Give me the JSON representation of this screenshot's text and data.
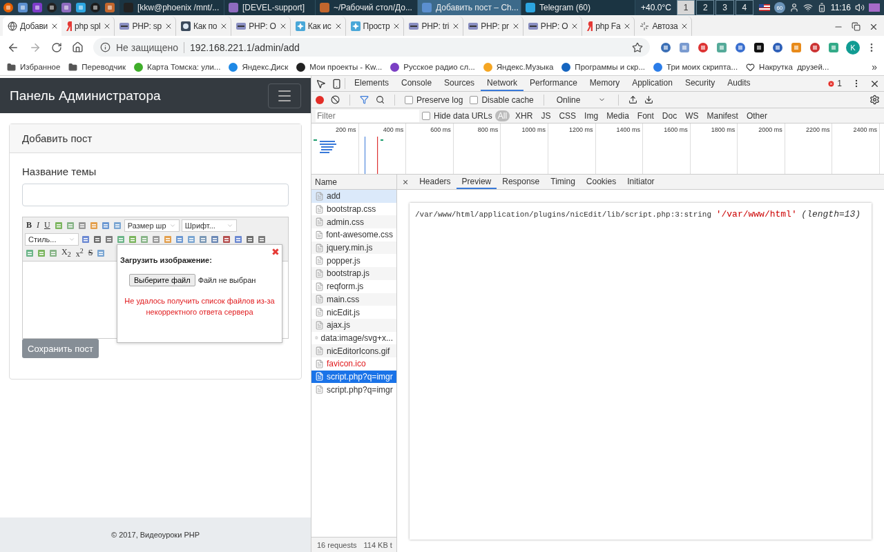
{
  "taskbar": {
    "windows": [
      {
        "title": "[kkw@phoenix /mnt/...",
        "kind": "terminal",
        "selected": false
      },
      {
        "title": "[DEVEL-support]",
        "kind": "folder",
        "selected": false
      },
      {
        "title": "~/Рабочий стол/До...",
        "kind": "editor",
        "selected": false
      },
      {
        "title": "Добавить пост – Ch...",
        "kind": "browser",
        "selected": true
      },
      {
        "title": "Telegram (60)",
        "kind": "telegram",
        "selected": false
      }
    ],
    "temperature": "+40.0°C",
    "workspaces": [
      {
        "label": "1",
        "selected": true
      },
      {
        "label": "2",
        "selected": false
      },
      {
        "label": "3",
        "selected": false
      },
      {
        "label": "4",
        "selected": false
      }
    ],
    "tray_badge": "60",
    "clock": "11:16"
  },
  "browser": {
    "tabs": [
      {
        "title": "Добави",
        "kind": "globe",
        "selected": true
      },
      {
        "title": "php spl",
        "kind": "yandex",
        "selected": false
      },
      {
        "title": "PHP: sp",
        "kind": "php",
        "selected": false
      },
      {
        "title": "Как по",
        "kind": "gem",
        "selected": false
      },
      {
        "title": "PHP: O",
        "kind": "php",
        "selected": false
      },
      {
        "title": "Как ис",
        "kind": "star",
        "selected": false
      },
      {
        "title": "Простр",
        "kind": "star",
        "selected": false
      },
      {
        "title": "PHP: tri",
        "kind": "php",
        "selected": false
      },
      {
        "title": "PHP: pr",
        "kind": "php",
        "selected": false
      },
      {
        "title": "PHP: O",
        "kind": "php",
        "selected": false
      },
      {
        "title": "php Fa",
        "kind": "yandex",
        "selected": false
      },
      {
        "title": "Автоза",
        "kind": "spinner",
        "selected": false
      }
    ],
    "security": "Не защищено",
    "url": "192.168.221.1/admin/add",
    "profile": "K",
    "bookmarks": [
      {
        "title": "Избранное",
        "kind": "folder"
      },
      {
        "title": "Переводчик",
        "kind": "folder"
      },
      {
        "title": "Карта Томска: ули...",
        "kind": "site",
        "color": "#3fae2a"
      },
      {
        "title": "Яндекс.Диск",
        "kind": "site",
        "color": "#1e88e5"
      },
      {
        "title": "Мои проекты - Kw...",
        "kind": "site",
        "color": "#222222"
      },
      {
        "title": "Русское радио сл...",
        "kind": "site",
        "color": "#7b3fc4"
      },
      {
        "title": "Яндекс.Музыка",
        "kind": "site",
        "color": "#f5a623"
      },
      {
        "title": "Программы и скр...",
        "kind": "site",
        "color": "#1565c0"
      },
      {
        "title": "Три моих скрипта...",
        "kind": "site",
        "color": "#2b7de9"
      },
      {
        "title": "Накрутка  друзей...",
        "kind": "heart"
      }
    ],
    "bookmarks_more": "»"
  },
  "admin": {
    "brand": "Панель Администратора",
    "card_title": "Добавить пост",
    "field_label": "Название темы",
    "toolbar": [
      [
        {
          "kind": "bold",
          "label": "B"
        },
        {
          "kind": "italic",
          "label": "I"
        },
        {
          "kind": "underline",
          "label": "U"
        },
        {
          "kind": "icon"
        },
        {
          "kind": "icon"
        },
        {
          "kind": "icon"
        },
        {
          "kind": "icon"
        },
        {
          "kind": "icon"
        },
        {
          "kind": "icon"
        },
        {
          "kind": "select",
          "label": "Размер шр"
        },
        {
          "kind": "select",
          "label": "Шрифт..."
        }
      ],
      [
        {
          "kind": "select",
          "label": "Стиль..."
        },
        {
          "kind": "icon"
        },
        {
          "kind": "icon"
        },
        {
          "kind": "icon"
        },
        {
          "kind": "icon"
        },
        {
          "kind": "icon"
        },
        {
          "kind": "icon"
        },
        {
          "kind": "icon"
        },
        {
          "kind": "icon"
        },
        {
          "kind": "icon"
        },
        {
          "kind": "icon"
        },
        {
          "kind": "icon"
        },
        {
          "kind": "icon"
        },
        {
          "kind": "icon"
        },
        {
          "kind": "icon"
        },
        {
          "kind": "icon"
        },
        {
          "kind": "icon"
        }
      ],
      [
        {
          "kind": "icon"
        },
        {
          "kind": "icon"
        },
        {
          "kind": "icon"
        },
        {
          "kind": "plain",
          "label": "X$_{2}$"
        },
        {
          "kind": "plain",
          "label": "x$^{2}$"
        },
        {
          "kind": "strike",
          "label": "S"
        },
        {
          "kind": "icon"
        }
      ]
    ],
    "upload_popup": {
      "title": "Загрузить изображение:",
      "close": "✖",
      "choose_button": "Выберите файл",
      "file_status": "Файл не выбран",
      "error": "Не удалось получить список файлов из-за некорректного ответа сервера"
    },
    "save_button": "Сохранить пост",
    "footer": "© 2017, Видеоуроки PHP"
  },
  "devtools": {
    "panels": [
      {
        "label": "Elements",
        "selected": false
      },
      {
        "label": "Console",
        "selected": false
      },
      {
        "label": "Sources",
        "selected": false
      },
      {
        "label": "Network",
        "selected": true
      },
      {
        "label": "Performance",
        "selected": false
      },
      {
        "label": "Memory",
        "selected": false
      },
      {
        "label": "Application",
        "selected": false
      },
      {
        "label": "Security",
        "selected": false
      },
      {
        "label": "Audits",
        "selected": false
      }
    ],
    "error_count": "1",
    "recording": true,
    "preserve_log": {
      "label": "Preserve log",
      "checked": false
    },
    "disable_cache": {
      "label": "Disable cache",
      "checked": false
    },
    "throttling": "Online",
    "filter": {
      "placeholder": "Filter"
    },
    "hide_data_urls": {
      "label": "Hide data URLs",
      "checked": false
    },
    "type_filters": [
      {
        "label": "All",
        "selected": true
      },
      {
        "label": "XHR",
        "selected": false
      },
      {
        "label": "JS",
        "selected": false
      },
      {
        "label": "CSS",
        "selected": false
      },
      {
        "label": "Img",
        "selected": false
      },
      {
        "label": "Media",
        "selected": false
      },
      {
        "label": "Font",
        "selected": false
      },
      {
        "label": "Doc",
        "selected": false
      },
      {
        "label": "WS",
        "selected": false
      },
      {
        "label": "Manifest",
        "selected": false
      },
      {
        "label": "Other",
        "selected": false
      }
    ],
    "timeline_ticks": [
      "200 ms",
      "400 ms",
      "600 ms",
      "800 ms",
      "1000 ms",
      "1200 ms",
      "1400 ms",
      "1600 ms",
      "1800 ms",
      "2000 ms",
      "2200 ms",
      "2400 ms"
    ],
    "name_header": "Name",
    "requests": [
      {
        "name": "add",
        "selected": false,
        "hovered": true,
        "failed": false
      },
      {
        "name": "bootstrap.css",
        "selected": false,
        "hovered": false,
        "failed": false
      },
      {
        "name": "admin.css",
        "selected": false,
        "hovered": false,
        "failed": false
      },
      {
        "name": "font-awesome.css",
        "selected": false,
        "hovered": false,
        "failed": false
      },
      {
        "name": "jquery.min.js",
        "selected": false,
        "hovered": false,
        "failed": false
      },
      {
        "name": "popper.js",
        "selected": false,
        "hovered": false,
        "failed": false
      },
      {
        "name": "bootstrap.js",
        "selected": false,
        "hovered": false,
        "failed": false
      },
      {
        "name": "reqform.js",
        "selected": false,
        "hovered": false,
        "failed": false
      },
      {
        "name": "main.css",
        "selected": false,
        "hovered": false,
        "failed": false
      },
      {
        "name": "nicEdit.js",
        "selected": false,
        "hovered": false,
        "failed": false
      },
      {
        "name": "ajax.js",
        "selected": false,
        "hovered": false,
        "failed": false
      },
      {
        "name": "data:image/svg+x...",
        "selected": false,
        "hovered": false,
        "failed": false
      },
      {
        "name": "nicEditorIcons.gif",
        "selected": false,
        "hovered": false,
        "failed": false
      },
      {
        "name": "favicon.ico",
        "selected": false,
        "hovered": false,
        "failed": true
      },
      {
        "name": "script.php?q=imgr",
        "selected": true,
        "hovered": false,
        "failed": false
      },
      {
        "name": "script.php?q=imgr",
        "selected": false,
        "hovered": false,
        "failed": false
      }
    ],
    "detail_close": "×",
    "detail_tabs": [
      {
        "label": "Headers",
        "selected": false
      },
      {
        "label": "Preview",
        "selected": true
      },
      {
        "label": "Response",
        "selected": false
      },
      {
        "label": "Timing",
        "selected": false
      },
      {
        "label": "Cookies",
        "selected": false
      },
      {
        "label": "Initiator",
        "selected": false
      }
    ],
    "preview": {
      "location": "/var/www/html/application/plugins/nicEdit/lib/script.php:3:string",
      "value": "'/var/www/html'",
      "length": "(length=13)"
    },
    "summary": [
      "16 requests",
      "114 KB t"
    ]
  }
}
